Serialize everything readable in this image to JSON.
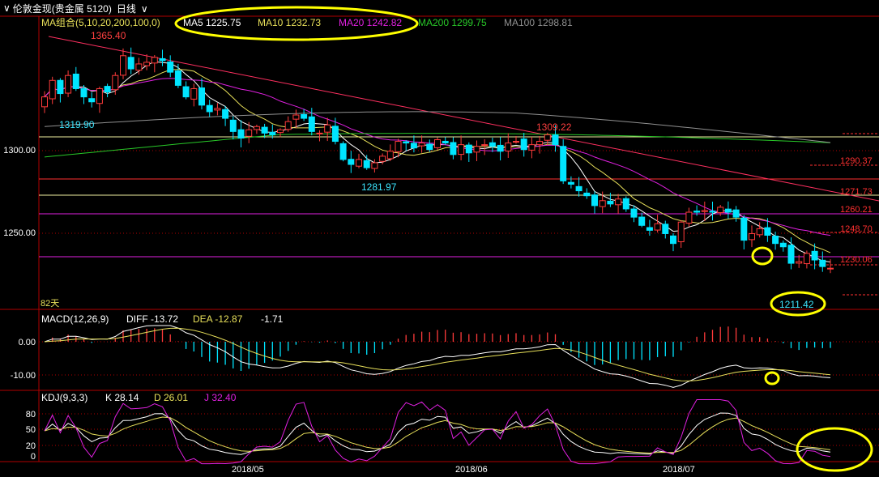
{
  "title": {
    "symbol": "伦敦金现(贵金属 5120)",
    "period": "日线",
    "period_arrow": "chevron-down-icon"
  },
  "colors": {
    "bg": "#000000",
    "up": "#ff3b3b",
    "down": "#00e5ff",
    "ma5": "#ffffff",
    "ma10": "#e8e05a",
    "ma20": "#e020e0",
    "ma200": "#28c828",
    "ma100": "#909090",
    "grid": "#b00000",
    "highlight": "#ffff00"
  },
  "ma_legend": {
    "label": "MA组合(5,10,20,200,100,0)",
    "items": [
      {
        "name": "MA5",
        "value": "MA5 1225.75"
      },
      {
        "name": "MA10",
        "value": "MA10 1232.73"
      },
      {
        "name": "MA20",
        "value": "MA20 1242.82"
      },
      {
        "name": "MA200",
        "value": "MA200 1299.75"
      },
      {
        "name": "MA100",
        "value": "MA100 1298.81"
      }
    ]
  },
  "macd_legend": {
    "label": "MACD(12,26,9)",
    "diff": "DIFF -13.72",
    "dea": "DEA -12.87",
    "macd": "-1.71"
  },
  "kdj_legend": {
    "label": "KDJ(9,3,3)",
    "k": "K 28.14",
    "d": "D 26.01",
    "j": "J 32.40"
  },
  "days_label": "82天",
  "x_labels": [
    "2018/05",
    "2018/06",
    "2018/07"
  ],
  "chart_data": {
    "type": "candlestick",
    "price_axis": {
      "ticks": [
        "1300.00",
        "1250.00"
      ],
      "ylim": [
        1197,
        1373
      ]
    },
    "macd_axis": {
      "ticks": [
        "0.00",
        "-10.00"
      ]
    },
    "kdj_axis": {
      "ticks": [
        "80",
        "50",
        "20",
        "0"
      ]
    },
    "annotations": [
      {
        "text": "1365.40",
        "kind": "high"
      },
      {
        "text": "1319.90",
        "kind": "low"
      },
      {
        "text": "1281.97",
        "kind": "low"
      },
      {
        "text": "1309.22",
        "kind": "high"
      },
      {
        "text": "1211.42",
        "kind": "low"
      }
    ],
    "horizontal_levels": [
      "1290.37",
      "1271.73",
      "1260.21",
      "1248.70",
      "1230.06"
    ],
    "closes": [
      1325,
      1335,
      1327,
      1338,
      1330,
      1325,
      1322,
      1330,
      1328,
      1338,
      1350,
      1342,
      1345,
      1346,
      1349,
      1347,
      1340,
      1332,
      1325,
      1330,
      1320,
      1316,
      1318,
      1312,
      1304,
      1300,
      1305,
      1307,
      1303,
      1302,
      1305,
      1310,
      1314,
      1312,
      1304,
      1303,
      1308,
      1298,
      1287,
      1284,
      1287,
      1282,
      1285,
      1289,
      1292,
      1298,
      1297,
      1294,
      1297,
      1293,
      1299,
      1297,
      1290,
      1296,
      1291,
      1295,
      1296,
      1295,
      1292,
      1297,
      1298,
      1293,
      1296,
      1298,
      1302,
      1296,
      1274,
      1272,
      1268,
      1265,
      1259,
      1262,
      1260,
      1263,
      1257,
      1252,
      1247,
      1244,
      1248,
      1242,
      1236,
      1249,
      1255,
      1255,
      1256,
      1255,
      1258,
      1255,
      1252,
      1238,
      1242,
      1245,
      1241,
      1236,
      1234,
      1224,
      1225,
      1230,
      1226,
      1222,
      1221
    ]
  }
}
